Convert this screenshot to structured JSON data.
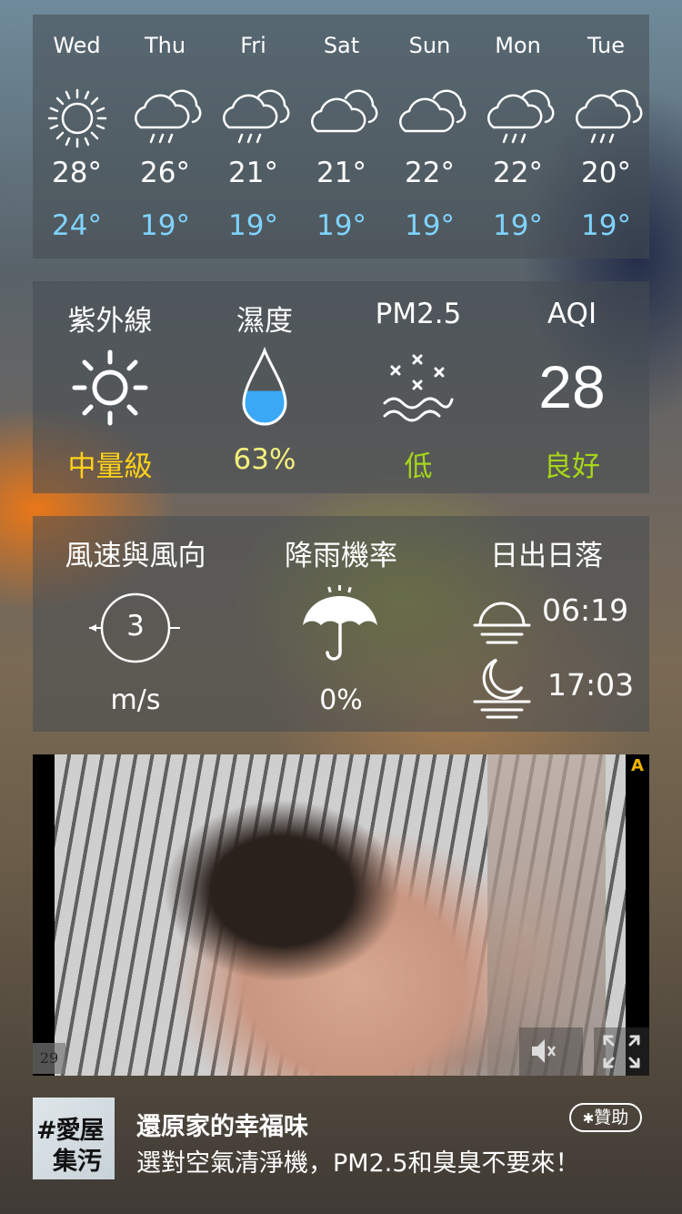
{
  "forecast": [
    {
      "day": "Wed",
      "high": "28°",
      "low": "24°",
      "icon": "sun-icon"
    },
    {
      "day": "Thu",
      "high": "26°",
      "low": "19°",
      "icon": "rain-cloud-icon"
    },
    {
      "day": "Fri",
      "high": "21°",
      "low": "19°",
      "icon": "rain-cloud-icon"
    },
    {
      "day": "Sat",
      "high": "21°",
      "low": "19°",
      "icon": "cloud-icon"
    },
    {
      "day": "Sun",
      "high": "22°",
      "low": "19°",
      "icon": "cloud-icon"
    },
    {
      "day": "Mon",
      "high": "22°",
      "low": "19°",
      "icon": "rain-cloud-icon"
    },
    {
      "day": "Tue",
      "high": "20°",
      "low": "19°",
      "icon": "rain-cloud-icon"
    }
  ],
  "env": {
    "uv": {
      "label": "紫外線",
      "value": "中量級",
      "color": "#ffd21a"
    },
    "humidity": {
      "label": "濕度",
      "value": "63%",
      "color": "#f4f07c",
      "fill": 0.45
    },
    "pm25": {
      "label": "PM2.5",
      "value": "低",
      "color": "#a6d617"
    },
    "aqi": {
      "label": "AQI",
      "number": "28",
      "value": "良好",
      "color": "#a6d617"
    }
  },
  "wind": {
    "label": "風速與風向",
    "speed": "3",
    "unit": "m/s",
    "rain_label": "降雨機率",
    "rain_value": "0%",
    "sun_label": "日出日落",
    "sunrise": "06:19",
    "sunset": "17:03"
  },
  "ad": {
    "countdown": "29",
    "logo_line1": "#愛屋",
    "logo_line2": "集汚",
    "title": "還原家的幸福味",
    "subtitle": "選對空氣清淨機，PM2.5和臭臭不要來！",
    "sponsor": "贊助",
    "ad_badge": "A"
  },
  "colors": {
    "low_temp": "#7fd3ff",
    "humidity_water": "#3aa8f5"
  }
}
